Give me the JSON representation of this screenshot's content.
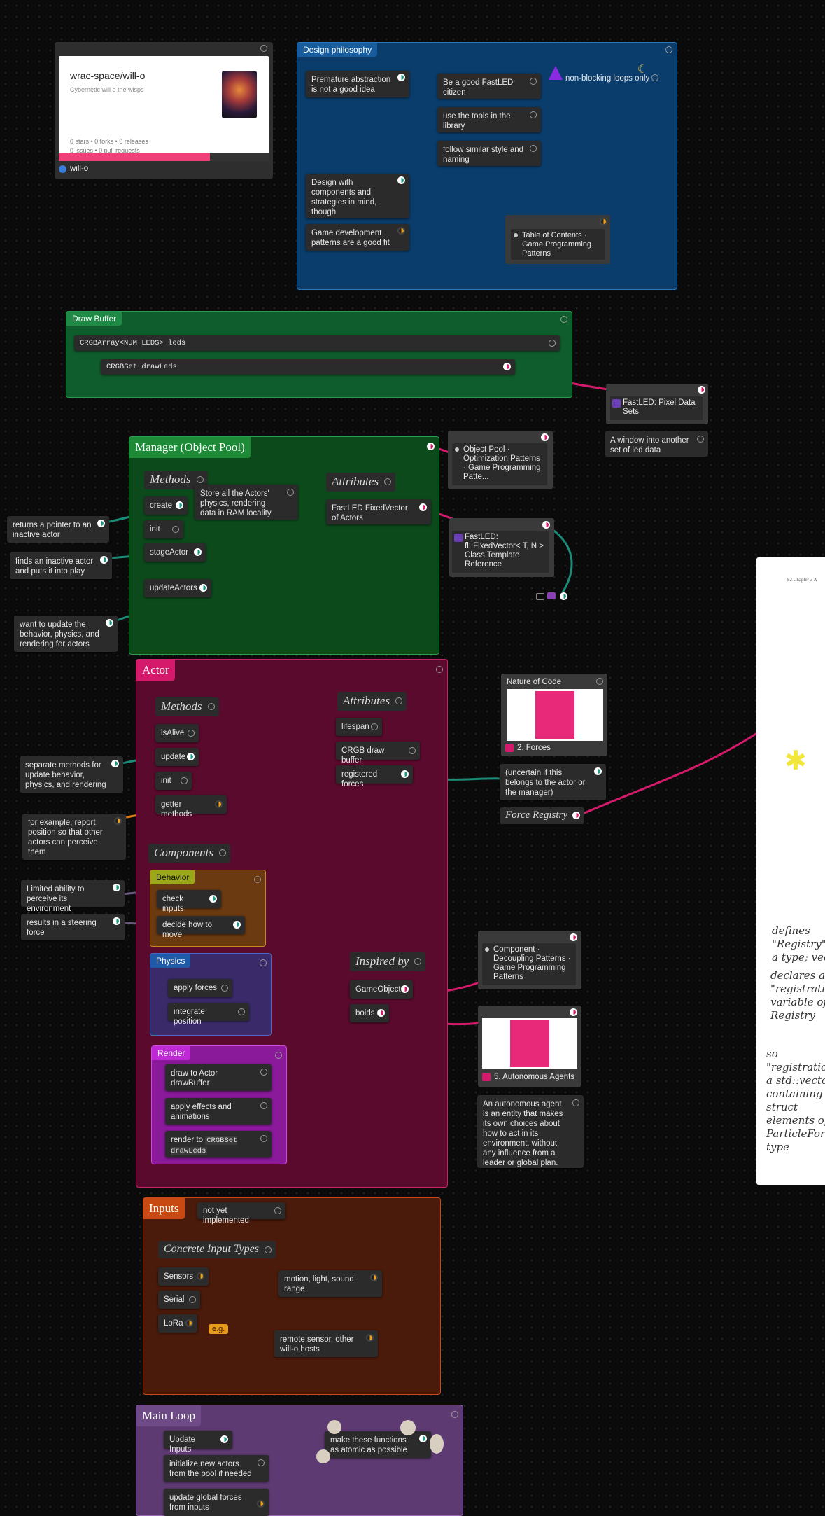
{
  "repo_card": {
    "title": "wrac-space/will-o",
    "subtitle": "Cybernetic will o the wisps",
    "stats1": "0 stars • 0 forks • 0 releases",
    "stats2": "0 issues • 0 pull requests",
    "footer": "will-o"
  },
  "design_philosophy": {
    "title": "Design philosophy",
    "premature": "Premature abstraction is not a good idea",
    "citizen": "Be a good FastLED citizen",
    "tools": "use the tools in the library",
    "style": "follow similar style and naming",
    "design_components": "Design with components and strategies in mind, though",
    "game_patterns": "Game development patterns are a good fit",
    "nonblocking": "non-blocking loops only",
    "toc": "Table of Contents · Game Programming Patterns"
  },
  "draw_buffer": {
    "title": "Draw Buffer",
    "leds": "CRGBArray<NUM_LEDS> leds",
    "drawleds": "CRGBSet drawLeds"
  },
  "fastled_pixel": {
    "title": "FastLED: Pixel Data Sets",
    "note": "A window into another set of led data"
  },
  "manager": {
    "title": "Manager (Object Pool)",
    "methods": "Methods",
    "create": "create",
    "init": "init",
    "stage": "stageActor",
    "update": "updateActors",
    "store_note": "Store all the Actors' physics, rendering data in RAM locality",
    "attributes": "Attributes",
    "fixed_vector": "FastLED FixedVector of Actors"
  },
  "object_pool_link": "Object Pool · Optimization Patterns · Game Programming Patte...",
  "fixedvector_link": "FastLED: fl::FixedVector< T, N > Class Template Reference",
  "side_notes": {
    "pointer": "returns a pointer to an inactive actor",
    "finds": "finds an inactive actor and puts it into play",
    "want_update": "want to update the behavior, physics, and rendering for actors",
    "separate": "separate methods for update behavior, physics, and rendering",
    "report": "for example, report position so that other actors can perceive them",
    "limited": "Limited ability to perceive its environment",
    "steering": "results in a steering force"
  },
  "actor": {
    "title": "Actor",
    "methods": "Methods",
    "isalive": "isAlive",
    "update": "update",
    "init": "init",
    "getter": "getter methods",
    "attributes": "Attributes",
    "lifespan": "lifespan",
    "crgb_buffer": "CRGB draw buffer",
    "forces": "registered forces",
    "components": "Components",
    "behavior": "Behavior",
    "check_inputs": "check inputs",
    "decide": "decide how to move",
    "physics": "Physics",
    "apply_forces": "apply forces",
    "integrate": "integrate position",
    "render": "Render",
    "draw_actor": "draw to Actor drawBuffer",
    "apply_effects": "apply effects and animations",
    "render_to": "render to",
    "render_code": "CRGBSet drawLeds",
    "inspired": "Inspired by",
    "gameobject": "GameObject",
    "boids": "boids"
  },
  "nature_of_code": {
    "title": "Nature of Code",
    "forces": "2. Forces",
    "uncertain": "(uncertain if this belongs to the actor or the manager)",
    "force_registry": "Force Registry"
  },
  "component_link": "Component · Decoupling Patterns · Game Programming Patterns",
  "autonomous": {
    "title": "5. Autonomous Agents",
    "note": "An autonomous agent is an entity that makes its own choices about how to act in its environment, without any influence from a leader or global plan."
  },
  "inputs": {
    "title": "Inputs",
    "not_impl": "not yet implemented",
    "concrete": "Concrete Input Types",
    "sensors": "Sensors",
    "serial": "Serial",
    "lora": "LoRa",
    "motion": "motion, light, sound, range",
    "eg": "e.g.",
    "remote": "remote sensor, other will-o hosts"
  },
  "main_loop": {
    "title": "Main Loop",
    "update_inputs": "Update Inputs",
    "atomic": "make these functions as atomic as possible",
    "init_new": "initialize new actors from the pool if needed",
    "update_global": "update global forces from inputs"
  },
  "paper": {
    "header": "82  Chapter 3  A",
    "hand1": "defines\n\"Registry\" as\na type; vec",
    "hand2": "declares a\n\"registrations\"\nvariable of typ\nRegistry",
    "hand3": "so\n\"registrations\" i\na std::vector\ncontaining\nstruct\nelements of\nParticleForce\ntype"
  },
  "colors": {
    "design_blue": "#0a3d6b",
    "draw_green": "#0f5d2c",
    "manager_green": "#0c4a1c",
    "actor_magenta": "#5a0a2c",
    "inputs_rust": "#4a1a0a",
    "main_loop_purple": "#5e3a72",
    "teal_edge": "#1a8c78",
    "pink_edge": "#d61a6b",
    "orange_edge": "#e07a12"
  }
}
